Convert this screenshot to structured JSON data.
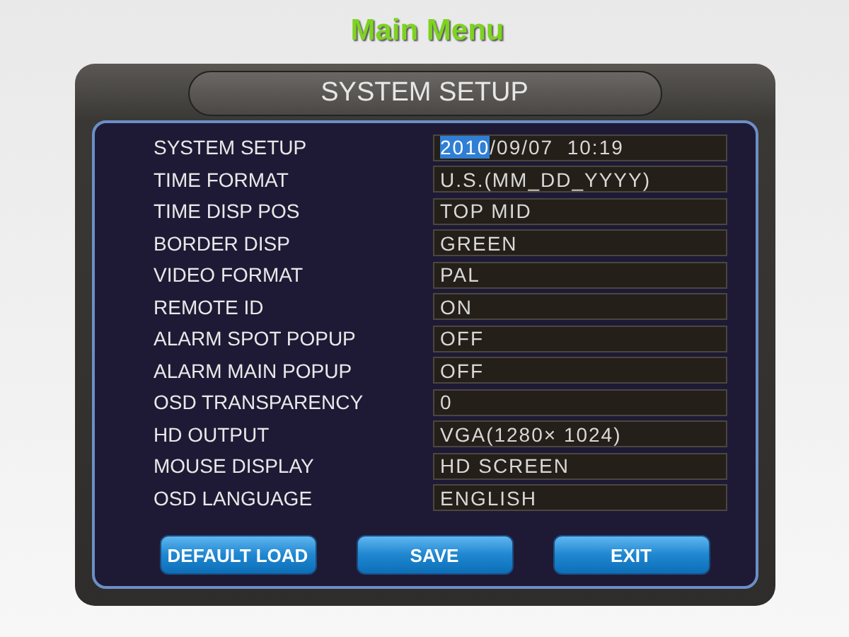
{
  "heading": "Main Menu",
  "panel_title": "SYSTEM SETUP",
  "rows": [
    {
      "label": "SYSTEM SETUP",
      "segments": [
        {
          "text": "2010",
          "selected": true
        },
        {
          "text": "/09/07  10:19",
          "selected": false
        }
      ]
    },
    {
      "label": "TIME FORMAT",
      "value": "U.S.(MM_DD_YYYY)"
    },
    {
      "label": "TIME DISP POS",
      "value": "TOP MID"
    },
    {
      "label": "BORDER DISP",
      "value": "GREEN"
    },
    {
      "label": "VIDEO FORMAT",
      "value": "PAL"
    },
    {
      "label": "REMOTE ID",
      "value": "ON"
    },
    {
      "label": "ALARM SPOT POPUP",
      "value": "OFF"
    },
    {
      "label": "ALARM MAIN POPUP",
      "value": "OFF"
    },
    {
      "label": "OSD TRANSPARENCY",
      "value": "0"
    },
    {
      "label": "HD OUTPUT",
      "value": "VGA(1280× 1024)"
    },
    {
      "label": "MOUSE DISPLAY",
      "value": "HD SCREEN"
    },
    {
      "label": "OSD LANGUAGE",
      "value": "ENGLISH"
    }
  ],
  "buttons": [
    "DEFAULT LOAD",
    "SAVE",
    "EXIT"
  ]
}
